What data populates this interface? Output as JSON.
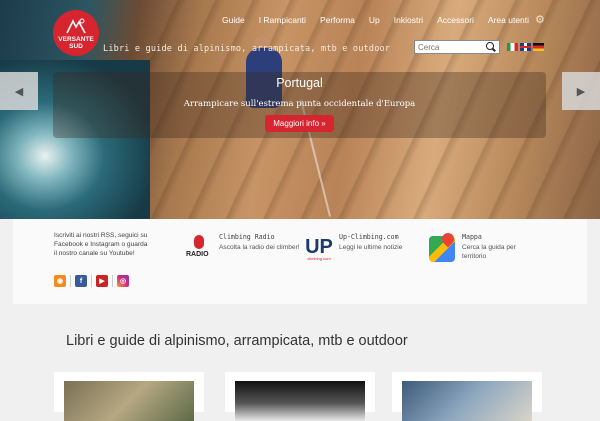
{
  "brand": {
    "logo_text_line1": "VERSANTE",
    "logo_text_line2": "SUD",
    "tagline": "Libri e guide di alpinismo, arrampicata, mtb e outdoor"
  },
  "nav": {
    "items": [
      "Guide",
      "I Rampicanti",
      "Performa",
      "Up",
      "Inkiostri",
      "Accessori",
      "Area utenti"
    ]
  },
  "search": {
    "placeholder": "Cerca",
    "value": "Cerca"
  },
  "slider": {
    "title": "Portugal",
    "subtitle": "Arrampicare sull'estrema punta occidentale d'Europa",
    "cta_label": "Maggiori info »",
    "prev_symbol": "◀",
    "next_symbol": "▶"
  },
  "follow_text": "Iscriviti ai nostri RSS, seguici su Facebook e Instagram o guarda il nostro canale su Youtube!",
  "social": {
    "rss": "◉",
    "facebook": "f",
    "youtube": "▶",
    "instagram": "◎"
  },
  "features": [
    {
      "title": "Climbing Radio",
      "desc": "Ascolta la radio dei climber!",
      "icon": "radio-icon",
      "badge": "RADIO"
    },
    {
      "title": "Up-Climbing.com",
      "desc": "Leggi le ultime notizie",
      "icon": "up-climbing-logo",
      "badge": "UP",
      "badge_sub": "climbing.com"
    },
    {
      "title": "Mappa",
      "desc": "Cerca la guida per territorio",
      "icon": "maps-icon"
    }
  ],
  "main": {
    "title": "Libri e guide di alpinismo, arrampicata, mtb e outdoor"
  },
  "colors": {
    "accent": "#d6252e",
    "strip_bg": "#fafafa"
  }
}
